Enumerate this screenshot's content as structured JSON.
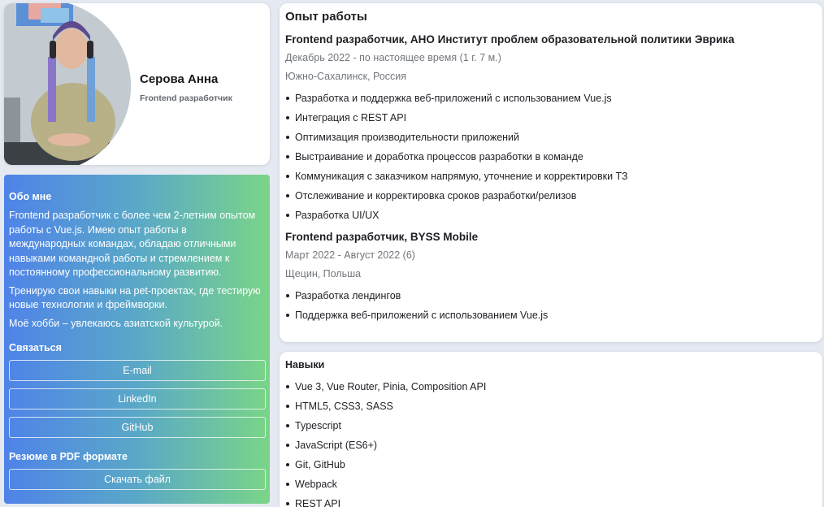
{
  "profile": {
    "name": "Серова Анна",
    "role": "Frontend разработчик"
  },
  "sidebar": {
    "about_title": "Обо мне",
    "about_paragraphs": [
      "Frontend разработчик с более чем 2-летним опытом работы с Vue.js. Имею опыт работы в международных командах, обладаю отличными навыками командной работы и стремлением к постоянному профессиональному развитию.",
      "Тренирую свои навыки на pet-проектах, где тестирую новые технологии и фреймворки.",
      "Моё хобби – увлекаюсь азиатской культурой."
    ],
    "contact_title": "Связаться",
    "contact_buttons": [
      "E-mail",
      "LinkedIn",
      "GitHub"
    ],
    "pdf_title": "Резюме в PDF формате",
    "download_label": "Скачать файл",
    "gradient_colors": [
      "#4f83e8",
      "#7ad587"
    ]
  },
  "experience": {
    "heading": "Опыт работы",
    "jobs": [
      {
        "title": "Frontend разработчик, АНО Институт проблем образовательной политики Эврика",
        "period": "Декабрь 2022 - по настоящее время (1 г. 7 м.)",
        "location": "Южно-Сахалинск, Россия",
        "duties": [
          "Разработка и поддержка веб-приложений с использованием Vue.js",
          "Интеграция с REST API",
          "Оптимизация производительности приложений",
          "Выстраивание и доработка процессов разработки в команде",
          "Коммуникация с заказчиком напрямую, уточнение и корректировки ТЗ",
          "Отслеживание и корректировка сроков разработки/релизов",
          "Разработка UI/UX"
        ]
      },
      {
        "title": "Frontend разработчик, BYSS Mobile",
        "period": "Март 2022 - Август 2022 (6)",
        "location": "Щецин, Польша",
        "duties": [
          "Разработка лендингов",
          "Поддержка веб-приложений с использованием Vue.js"
        ]
      }
    ]
  },
  "skills": {
    "heading": "Навыки",
    "items": [
      "Vue 3, Vue Router, Pinia, Composition API",
      "HTML5, CSS3, SASS",
      "Typescript",
      "JavaScript (ES6+)",
      "Git, GitHub",
      "Webpack",
      "REST API"
    ]
  }
}
